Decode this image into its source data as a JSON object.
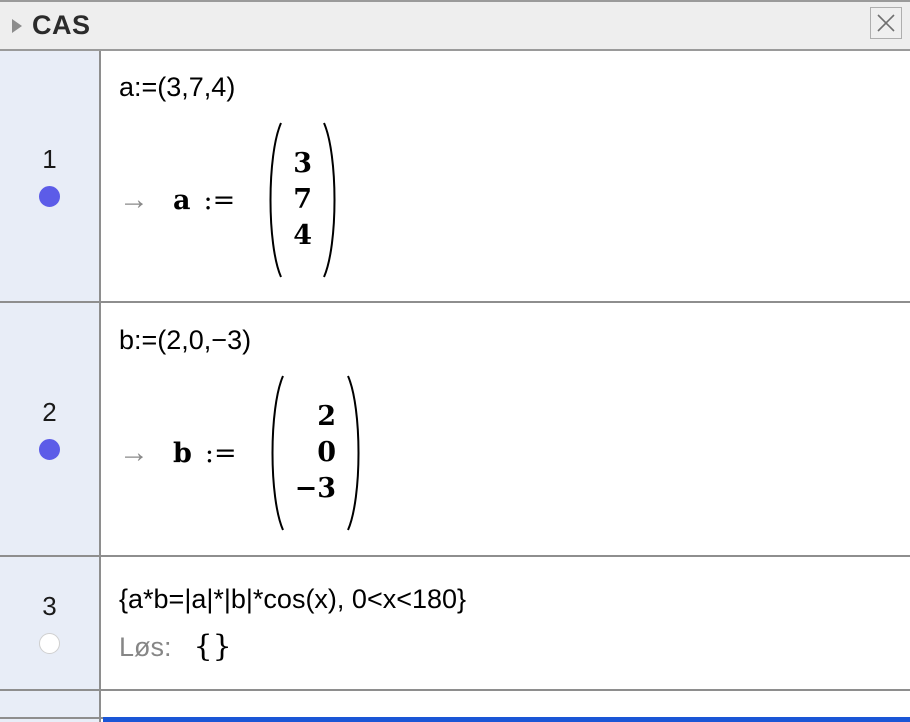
{
  "header": {
    "title": "CAS",
    "collapse_icon": "triangle-right-icon",
    "close_icon": "close-x-icon"
  },
  "colors": {
    "header_bg": "#eeeeee",
    "gutter_bg": "#e8edf7",
    "border": "#8e8e8e",
    "marker_filled": "#5c5ce8",
    "marker_hollow": "#ffffff",
    "selection_bar": "#1a56d6",
    "arrow": "#8a8a8a",
    "solve_label": "#868686"
  },
  "rows": [
    {
      "number": "1",
      "marker": "filled",
      "input": "a:=(3,7,4)",
      "output": {
        "type": "vector-assignment",
        "arrow": "→",
        "variable": "a",
        "assign": ":=",
        "vector": [
          "3",
          "7",
          "4"
        ]
      }
    },
    {
      "number": "2",
      "marker": "filled",
      "input": "b:=(2,0,−3)",
      "output": {
        "type": "vector-assignment",
        "arrow": "→",
        "variable": "b",
        "assign": ":=",
        "vector": [
          "2",
          "0",
          "−3"
        ]
      }
    },
    {
      "number": "3",
      "marker": "hollow",
      "input": "{a*b=|a|*|b|*cos(x), 0<x<180}",
      "output": {
        "type": "solve",
        "label": "Løs:",
        "value": "{}"
      }
    }
  ],
  "empty_row": {
    "number": "",
    "input": ""
  }
}
